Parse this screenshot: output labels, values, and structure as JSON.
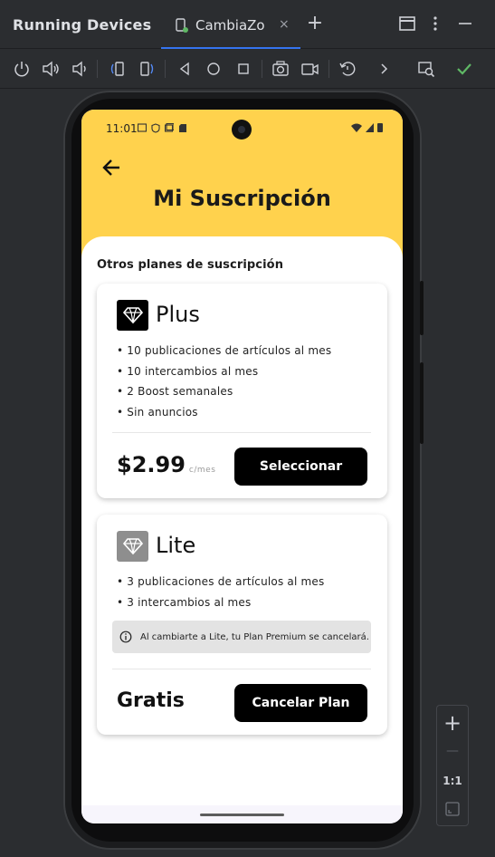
{
  "ide": {
    "panel_title": "Running Devices",
    "tab_label": "CambiaZo",
    "tab_close": "×",
    "add_tab": "+",
    "zoom_in": "+",
    "zoom_out": "—",
    "zoom_actual": "1:1"
  },
  "device": {
    "status_time": "11:01"
  },
  "app": {
    "title": "Mi Suscripción",
    "section_label": "Otros planes de suscripción",
    "plans": [
      {
        "name": "Plus",
        "features": [
          "• 10 publicaciones de artículos al mes",
          "• 10 intercambios al mes",
          "• 2 Boost semanales",
          "• Sin anuncios"
        ],
        "price": "$2.99",
        "price_unit": "c/mes",
        "action": "Seleccionar",
        "badge_color": "#000000"
      },
      {
        "name": "Lite",
        "features": [
          "• 3 publicaciones de artículos al mes",
          "• 3 intercambios al mes"
        ],
        "notice": "Al cambiarte a Lite, tu Plan Premium se cancelará.",
        "price": "Gratis",
        "action": "Cancelar Plan",
        "badge_color": "#8e8e8e"
      }
    ]
  },
  "colors": {
    "header_yellow": "#ffd24d",
    "ide_accent": "#3574f0",
    "check_green": "#5fb865"
  }
}
